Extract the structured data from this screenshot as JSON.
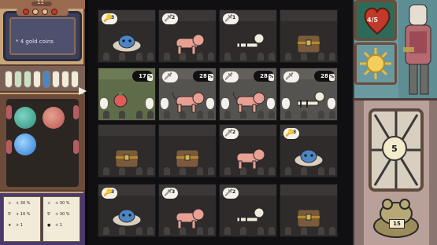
{
  "hud": {
    "top_counter": "11",
    "message": "* 4 gold coins",
    "player_hp": "4/5",
    "gate_key_count": "5",
    "frog_count": "15"
  },
  "stats": [
    {
      "icon": "sword",
      "value": "+ 30 %"
    },
    {
      "icon": "sword",
      "value": "+ 30 %"
    },
    {
      "icon": "shield",
      "value": "+ 10 %"
    },
    {
      "icon": "shield",
      "value": "+ 30 %"
    },
    {
      "icon": "star",
      "value": "+ 1"
    },
    {
      "icon": "drop",
      "value": "+ 1"
    }
  ],
  "grid": {
    "rows": [
      [
        {
          "type": "slime",
          "badge_icon": "key-icon",
          "badge_value": "3"
        },
        {
          "type": "dog",
          "badge_icon": "sword-icon",
          "badge_value": "2"
        },
        {
          "type": "skeleton",
          "badge_icon": "sword-icon",
          "badge_value": "1"
        },
        {
          "type": "chest",
          "badge_icon": "",
          "badge_value": ""
        }
      ],
      [
        {
          "type": "potion",
          "damage": "17",
          "hint": "%"
        },
        {
          "type": "dog",
          "badge_icon": "sword-icon",
          "badge_value": "",
          "damage": "28",
          "hint": "%"
        },
        {
          "type": "dog",
          "badge_icon": "sword-icon",
          "badge_value": "",
          "damage": "28",
          "hint": "%"
        },
        {
          "type": "skeleton",
          "badge_icon": "sword-icon",
          "badge_value": "",
          "damage": "28",
          "hint": "%"
        }
      ],
      [
        {
          "type": "chest",
          "badge_icon": "",
          "badge_value": ""
        },
        {
          "type": "chest",
          "badge_icon": "",
          "badge_value": ""
        },
        {
          "type": "dog",
          "badge_icon": "sword-icon",
          "badge_value": "2"
        },
        {
          "type": "slime",
          "badge_icon": "key-icon",
          "badge_value": "3"
        }
      ],
      [
        {
          "type": "slime",
          "badge_icon": "key-icon",
          "badge_value": "3"
        },
        {
          "type": "dog",
          "badge_icon": "sword-icon",
          "badge_value": "3"
        },
        {
          "type": "skeleton",
          "badge_icon": "sword-icon",
          "badge_value": "2"
        },
        {
          "type": "chest",
          "badge_icon": "",
          "badge_value": ""
        }
      ]
    ]
  },
  "colors": {
    "accent_red": "#c0392b",
    "badge_bg": "#f4f1ea",
    "highlight_row": "#5f6c4a"
  }
}
